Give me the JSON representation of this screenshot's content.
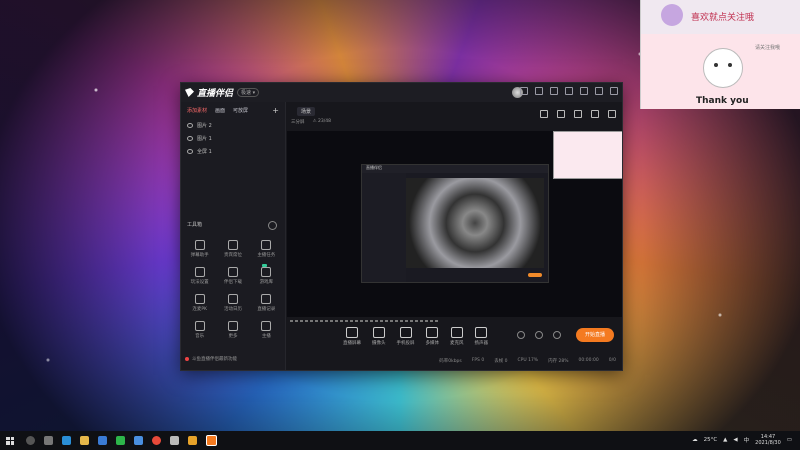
{
  "app": {
    "logo_text": "直播伴侣",
    "version_badge": "极速 ▾",
    "titlebar_icons": [
      "bell-icon",
      "skin-icon",
      "shirt-icon",
      "menu-icon",
      "minimize-icon",
      "maximize-icon",
      "close-icon"
    ]
  },
  "sidebar": {
    "tabs": [
      "添加素材",
      "画面",
      "可放屏"
    ],
    "active_tab": 0,
    "add_label": "+",
    "sources": [
      {
        "label": "图片 2"
      },
      {
        "label": "图片 1"
      },
      {
        "label": "全屏 1"
      }
    ],
    "tools_title": "工具箱",
    "tools": [
      {
        "label": "弹幕助手",
        "icon": "comment-icon"
      },
      {
        "label": "贵宾席位",
        "icon": "user-icon"
      },
      {
        "label": "主播任务",
        "icon": "task-icon"
      },
      {
        "label": "玩法设置",
        "icon": "game-icon"
      },
      {
        "label": "伴侣下载",
        "icon": "download-icon"
      },
      {
        "label": "游戏库",
        "icon": "gamepad-icon"
      },
      {
        "label": "连麦PK",
        "icon": "link-icon"
      },
      {
        "label": "活动日历",
        "icon": "calendar-icon"
      },
      {
        "label": "直播记录",
        "icon": "record-icon"
      },
      {
        "label": "音乐",
        "icon": "music-icon"
      },
      {
        "label": "更多",
        "icon": "more-icon"
      },
      {
        "label": "主播",
        "icon": "mic-icon"
      }
    ],
    "ticker": "斗鱼直播伴侣最新功能"
  },
  "scene": {
    "tab_label": "场景",
    "sub_labels": [
      "三分屏",
      "⚠ 23/48"
    ],
    "icons": [
      "layout-icon",
      "lock-icon",
      "music-icon",
      "bell-icon",
      "share-icon"
    ]
  },
  "preview": {
    "mini_title": "直播伴侣"
  },
  "controls": [
    {
      "label": "直播屏幕",
      "icon": "screen-icon"
    },
    {
      "label": "摄像头",
      "icon": "camera-icon"
    },
    {
      "label": "手机投屏",
      "icon": "phone-cast-icon"
    },
    {
      "label": "多媒体",
      "icon": "media-icon"
    },
    {
      "label": "麦克风",
      "icon": "mic-icon"
    },
    {
      "label": "扬声器",
      "icon": "speaker-icon"
    }
  ],
  "start_button": "开始直播",
  "status_bar": [
    "码率0kbps",
    "FPS 0",
    "丢帧 0",
    "CPU 17%",
    "内存 28%",
    "00:00:00",
    "0/0"
  ],
  "overlay": {
    "title": "喜欢就点关注哦",
    "small": "请关注我哦",
    "thank_you": "Thank you"
  },
  "taskbar": {
    "apps": [
      "explorer",
      "edge",
      "folder",
      "store",
      "mail",
      "chrome",
      "gear",
      "app6",
      "douyu-app"
    ],
    "weather": "25°C",
    "time": "14:47",
    "date": "2021/8/30"
  },
  "colors": {
    "accent": "#f47a20",
    "active_tab": "#ff6b6b",
    "window_bg": "#17171c"
  }
}
